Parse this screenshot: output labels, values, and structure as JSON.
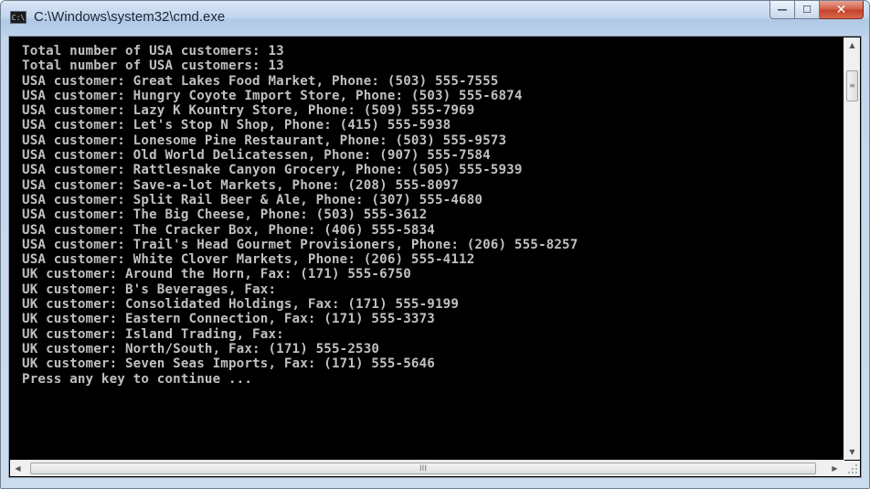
{
  "window": {
    "title": "C:\\Windows\\system32\\cmd.exe",
    "icon": "cmd-icon",
    "icon_text": "C:\\",
    "buttons": {
      "minimize": "—",
      "maximize": "☐",
      "close": "✕"
    }
  },
  "console": {
    "lines": [
      "Total number of USA customers: 13",
      "Total number of USA customers: 13",
      "USA customer: Great Lakes Food Market, Phone: (503) 555-7555",
      "USA customer: Hungry Coyote Import Store, Phone: (503) 555-6874",
      "USA customer: Lazy K Kountry Store, Phone: (509) 555-7969",
      "USA customer: Let's Stop N Shop, Phone: (415) 555-5938",
      "USA customer: Lonesome Pine Restaurant, Phone: (503) 555-9573",
      "USA customer: Old World Delicatessen, Phone: (907) 555-7584",
      "USA customer: Rattlesnake Canyon Grocery, Phone: (505) 555-5939",
      "USA customer: Save-a-lot Markets, Phone: (208) 555-8097",
      "USA customer: Split Rail Beer & Ale, Phone: (307) 555-4680",
      "USA customer: The Big Cheese, Phone: (503) 555-3612",
      "USA customer: The Cracker Box, Phone: (406) 555-5834",
      "USA customer: Trail's Head Gourmet Provisioners, Phone: (206) 555-8257",
      "USA customer: White Clover Markets, Phone: (206) 555-4112",
      "UK customer: Around the Horn, Fax: (171) 555-6750",
      "UK customer: B's Beverages, Fax:",
      "UK customer: Consolidated Holdings, Fax: (171) 555-9199",
      "UK customer: Eastern Connection, Fax: (171) 555-3373",
      "UK customer: Island Trading, Fax:",
      "UK customer: North/South, Fax: (171) 555-2530",
      "UK customer: Seven Seas Imports, Fax: (171) 555-5646",
      "Press any key to continue ..."
    ]
  },
  "scrollbars": {
    "up_arrow": "▲",
    "down_arrow": "▼",
    "left_arrow": "◀",
    "right_arrow": "▶",
    "vthumb_grip": "≡",
    "hthumb_grip": "III"
  },
  "colors": {
    "console_bg": "#000000",
    "console_text": "#c0c0c0",
    "close_button": "#c4412a"
  }
}
